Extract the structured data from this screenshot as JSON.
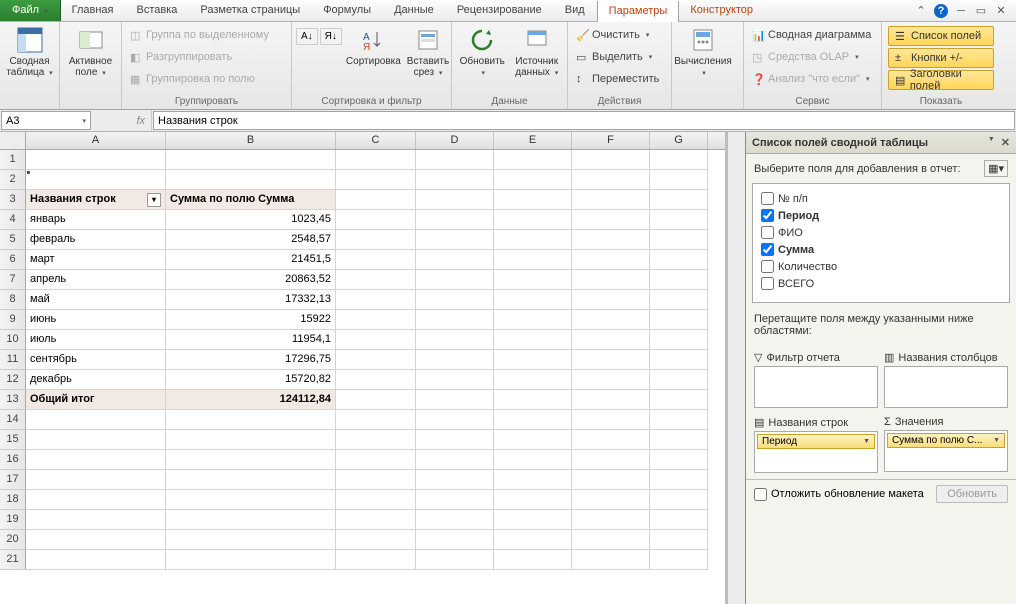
{
  "tabs": {
    "file": "Файл",
    "items": [
      "Главная",
      "Вставка",
      "Разметка страницы",
      "Формулы",
      "Данные",
      "Рецензирование",
      "Вид",
      "Параметры",
      "Конструктор"
    ],
    "active_index": 7
  },
  "ribbon": {
    "pivot_table": {
      "top": "Сводная",
      "bottom": "таблица",
      "group": ""
    },
    "active_field": {
      "top": "Активное",
      "bottom": "поле"
    },
    "group": {
      "label": "Группировать",
      "by_selection": "Группа по выделенному",
      "ungroup": "Разгруппировать",
      "by_field": "Группировка по полю"
    },
    "sort": {
      "sort_btn": "Сортировка",
      "insert_slicer_top": "Вставить",
      "insert_slicer_bottom": "срез",
      "group_label": "Сортировка и фильтр"
    },
    "data": {
      "refresh": "Обновить",
      "source_top": "Источник",
      "source_bottom": "данных",
      "group_label": "Данные"
    },
    "actions": {
      "clear": "Очистить",
      "select": "Выделить",
      "move": "Переместить",
      "group_label": "Действия"
    },
    "calc": {
      "btn": "Вычисления",
      "group_label": ""
    },
    "tools": {
      "chart": "Сводная диаграмма",
      "olap": "Средства OLAP",
      "whatif": "Анализ \"что если\"",
      "group_label": "Сервис"
    },
    "show": {
      "fields": "Список полей",
      "buttons": "Кнопки +/-",
      "headers": "Заголовки полей",
      "group_label": "Показать"
    }
  },
  "formula_bar": {
    "cell": "A3",
    "fx": "fx",
    "value": "Названия строк"
  },
  "columns": [
    "A",
    "B",
    "C",
    "D",
    "E",
    "F",
    "G"
  ],
  "pivot": {
    "header_rows": "Названия строк",
    "header_vals": "Сумма по полю Сумма",
    "rows": [
      {
        "n": "4",
        "label": "январь",
        "val": "1023,45"
      },
      {
        "n": "5",
        "label": "февраль",
        "val": "2548,57"
      },
      {
        "n": "6",
        "label": "март",
        "val": "21451,5"
      },
      {
        "n": "7",
        "label": "апрель",
        "val": "20863,52"
      },
      {
        "n": "8",
        "label": "май",
        "val": "17332,13"
      },
      {
        "n": "9",
        "label": "июнь",
        "val": "15922"
      },
      {
        "n": "10",
        "label": "июль",
        "val": "11954,1"
      },
      {
        "n": "11",
        "label": "сентябрь",
        "val": "17296,75"
      },
      {
        "n": "12",
        "label": "декабрь",
        "val": "15720,82"
      }
    ],
    "total_label": "Общий итог",
    "total_val": "124112,84"
  },
  "blank_rows": [
    "1",
    "2",
    "14",
    "15",
    "16",
    "17",
    "18",
    "19",
    "20",
    "21"
  ],
  "pane": {
    "title": "Список полей сводной таблицы",
    "instruction": "Выберите поля для добавления в отчет:",
    "fields": [
      {
        "label": "№ п/п",
        "checked": false
      },
      {
        "label": "Период",
        "checked": true
      },
      {
        "label": "ФИО",
        "checked": false
      },
      {
        "label": "Сумма",
        "checked": true
      },
      {
        "label": "Количество",
        "checked": false
      },
      {
        "label": "ВСЕГО",
        "checked": false
      }
    ],
    "drag_hint": "Перетащите поля между указанными ниже областями:",
    "area_filter": "Фильтр отчета",
    "area_cols": "Названия столбцов",
    "area_rows": "Названия строк",
    "area_vals": "Значения",
    "chip_rows": "Период",
    "chip_vals": "Сумма по полю С...",
    "defer": "Отложить обновление макета",
    "update": "Обновить"
  }
}
